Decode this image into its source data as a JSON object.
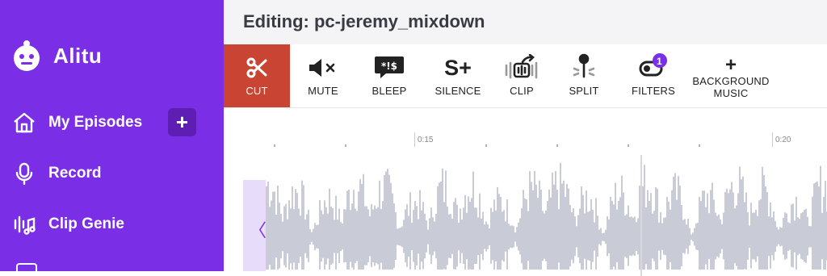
{
  "app": {
    "name": "Alitu"
  },
  "sidebar": {
    "items": [
      {
        "label": "My Episodes",
        "icon": "home-icon"
      },
      {
        "label": "Record",
        "icon": "microphone-icon"
      },
      {
        "label": "Clip Genie",
        "icon": "clip-genie-icon"
      }
    ],
    "add_label": "+"
  },
  "header": {
    "title": "Editing: pc-jeremy_mixdown"
  },
  "toolbar": {
    "tools": [
      {
        "label": "CUT",
        "icon": "scissors-icon",
        "active": true
      },
      {
        "label": "MUTE",
        "icon": "mute-icon"
      },
      {
        "label": "BLEEP",
        "icon": "bleep-icon"
      },
      {
        "label": "SILENCE",
        "icon": "silence-icon"
      },
      {
        "label": "CLIP",
        "icon": "clip-icon"
      },
      {
        "label": "SPLIT",
        "icon": "split-icon"
      },
      {
        "label": "FILTERS",
        "icon": "filters-icon",
        "badge": "1"
      },
      {
        "label": "BACKGROUND\nMUSIC",
        "icon": "plus-icon"
      }
    ]
  },
  "timeline": {
    "ticks": [
      "0:15",
      "0:20"
    ],
    "handle_glyph": "〈",
    "colors": {
      "waveform": "#c9ccd6",
      "handle": "#e8dcfb",
      "accent": "#7a2ee6",
      "active_tool": "#c94432"
    }
  }
}
